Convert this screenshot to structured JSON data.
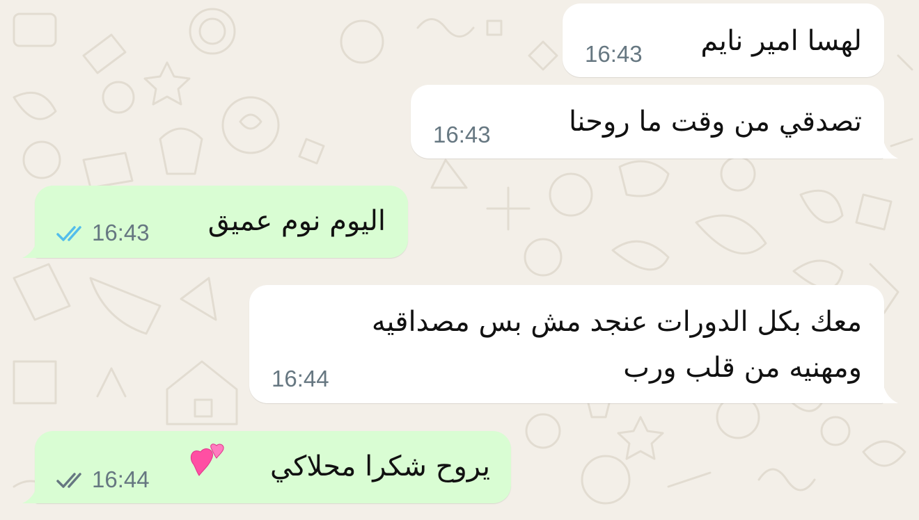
{
  "colors": {
    "background": "#f3efe8",
    "incoming_bubble": "#ffffff",
    "outgoing_bubble": "#d9fdd3",
    "read_ticks": "#53bdeb",
    "delivered_ticks": "#667781",
    "timestamp": "#667781"
  },
  "messages": [
    {
      "direction": "incoming",
      "text": "لهسا امير نايم",
      "time": "16:43"
    },
    {
      "direction": "incoming",
      "text": "تصدقي من وقت ما روحنا",
      "time": "16:43"
    },
    {
      "direction": "outgoing",
      "text": "اليوم نوم عميق",
      "time": "16:43",
      "status_icon": "double-check-read-icon"
    },
    {
      "direction": "incoming",
      "lines": [
        "معك بكل الدورات عنجد مش بس مصداقيه",
        "ومهنيه من قلب ورب"
      ],
      "time": "16:44"
    },
    {
      "direction": "outgoing",
      "text": "يروح شكرا محلاكي",
      "emoji_icon": "two-hearts-emoji",
      "time": "16:44",
      "status_icon": "double-check-delivered-icon"
    }
  ]
}
